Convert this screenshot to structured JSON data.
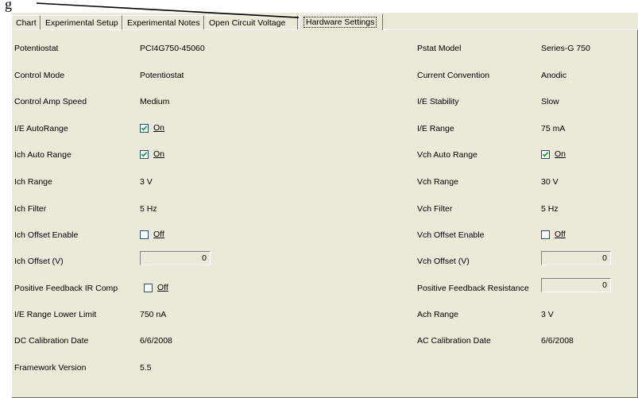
{
  "caption": "g",
  "tabs": [
    {
      "label": "Chart"
    },
    {
      "label": "Experimental Setup"
    },
    {
      "label": "Experimental Notes"
    },
    {
      "label": "Open Circuit Voltage"
    },
    {
      "label": "Hardware Settings"
    }
  ],
  "active_tab": "Hardware Settings",
  "left": {
    "potentiostat": {
      "label": "Potentiostat",
      "value": "PCI4G750-45060"
    },
    "control_mode": {
      "label": "Control Mode",
      "value": "Potentiostat"
    },
    "control_amp_speed": {
      "label": "Control Amp Speed",
      "value": "Medium"
    },
    "ie_autorange": {
      "label": "I/E AutoRange",
      "checkbox_label": "On",
      "checked": true
    },
    "ich_auto_range": {
      "label": "Ich Auto Range",
      "checkbox_label": "On",
      "checked": true
    },
    "ich_range": {
      "label": "Ich Range",
      "value": "3 V"
    },
    "ich_filter": {
      "label": "Ich Filter",
      "value": "5 Hz"
    },
    "ich_offset_enable": {
      "label": "Ich Offset Enable",
      "checkbox_label": "Off",
      "checked": false
    },
    "ich_offset": {
      "label": "Ich Offset (V)",
      "value": "0"
    },
    "positive_feedback_ir_comp": {
      "label": "Positive Feedback IR Comp",
      "checkbox_label": "Off",
      "checked": false
    },
    "ie_range_lower_limit": {
      "label": "I/E Range Lower Limit",
      "value": "750 nA"
    },
    "dc_calibration_date": {
      "label": "DC Calibration Date",
      "value": "6/6/2008"
    },
    "framework_version": {
      "label": "Framework Version",
      "value": "5.5"
    }
  },
  "right": {
    "pstat_model": {
      "label": "Pstat Model",
      "value": "Series-G 750"
    },
    "current_convention": {
      "label": "Current Convention",
      "value": "Anodic"
    },
    "ie_stability": {
      "label": "I/E Stability",
      "value": "Slow"
    },
    "ie_range": {
      "label": "I/E Range",
      "value": "75 mA"
    },
    "vch_auto_range": {
      "label": "Vch Auto Range",
      "checkbox_label": "On",
      "checked": true
    },
    "vch_range": {
      "label": "Vch Range",
      "value": "30 V"
    },
    "vch_filter": {
      "label": "Vch Filter",
      "value": "5 Hz"
    },
    "vch_offset_enable": {
      "label": "Vch Offset Enable",
      "checkbox_label": "Off",
      "checked": false
    },
    "vch_offset": {
      "label": "Vch Offset (V)",
      "value": "0"
    },
    "positive_feedback_resistance": {
      "label": "Positive Feedback Resistance",
      "value": "0"
    },
    "ach_range": {
      "label": "Ach Range",
      "value": "3 V"
    },
    "ac_calibration_date": {
      "label": "AC Calibration Date",
      "value": "6/6/2008"
    }
  },
  "colors": {
    "panel_bg": "#ece9d8",
    "checkbox_border": "#1c5180",
    "checkmark": "#21a121"
  }
}
